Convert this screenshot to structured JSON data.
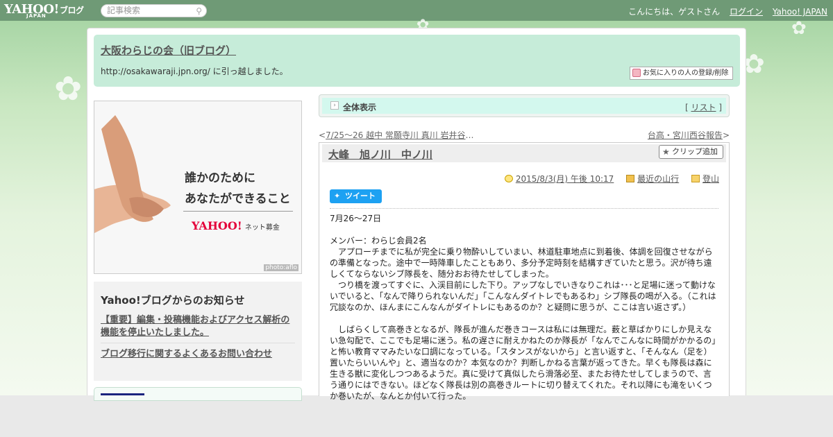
{
  "topbar": {
    "logo_text": "YAHOO!",
    "logo_sub": "JAPAN",
    "logo_blog": "ブログ",
    "search_placeholder": "記事検索",
    "greeting": "こんにちは、ゲストさん",
    "login": "ログイン",
    "yahoo_japan": "Yahoo! JAPAN"
  },
  "header": {
    "blog_title": "大阪わらじの会（旧ブログ）",
    "description": "http://osakawaraji.jpn.org/ に引っ越しました。",
    "fav_button": "お気に入りの人の登録/削除"
  },
  "banner": {
    "line1": "誰かのために",
    "line2": "あなたができること",
    "logo": "YAHOO!",
    "logo_suffix": "ネット募金",
    "photo_credit": "photo:aflo"
  },
  "notice": {
    "title": "Yahoo!ブログからのお知らせ",
    "links": [
      "【重要】編集・投稿機能およびアクセス解析の機能を停止いたしました。",
      "ブログ移行に関するよくあるお問い合わせ"
    ]
  },
  "allbar": {
    "label": "全体表示",
    "list_label": "リスト"
  },
  "nav": {
    "prev": "7/25～26 越中 常願寺川 真川 岩井谷",
    "prev_ellipsis": "…",
    "next": "台高・宮川西谷報告"
  },
  "article": {
    "title": "大峰　旭ノ川　中ノ川",
    "clip_button": "クリップ追加",
    "date": "2015/8/3(月) 午後 10:17",
    "category1": "最近の山行",
    "category2": "登山",
    "tweet": "ツイート",
    "body": [
      "7月26～27日",
      "",
      "メンバー：わらじ会員2名",
      "　アプローチまでに私が完全に乗り物酔いしていまい、林道駐車地点に到着後、体調を回復させながらの準備となった。途中で一時降車したこともあり、多分予定時刻を結構すぎていたと思う。沢が待ち遠しくてならないシブ隊長を、随分おお待たせしてしまった。",
      "　つり橋を渡ってすぐに、入渓目前にした下り。アップなしでいきなりこれは･･･と足場に迷って動けないでいると、「なんで降りられないんだ」「こんなんダイトレでもあるわ」シブ隊長の喝が入る。（これは冗談なのか、ほんまにこんなんがダイトレにもあるのか？と疑問に思うが、ここは言い返さず。）",
      "",
      "　しばらくして高巻きとなるが、隊長が進んだ巻きコースは私には無理だ。薮と草ばかりにしか見えない急勾配で、ここでも足場に迷う。私の遅さに耐えかねたのか隊長が「なんでこんなに時間がかかるの」と怖い教育ママみたいな口調になっている。「スタンスがないから」と言い返すと、「そんなん（足を）置いたらいいんや」と、適当なのか？本気なのか？判断しかねる言葉が返ってきた。早くも隊長は森に生きる獣に変化しつつあるようだ。真に受けて真似したら滑落必至、またお待たせしてしまうので、言う通りにはできない。ほどなく隊長は別の高巻きルートに切り替えてくれた。それ以降にも滝をいくつか巻いたが、なんとか付いて行った。"
    ]
  },
  "colors": {
    "topbar": "#6f9a76",
    "header_bg": "#c6ecd9",
    "allbar_bg": "#d3f8ee",
    "tweet": "#1da1f2"
  }
}
